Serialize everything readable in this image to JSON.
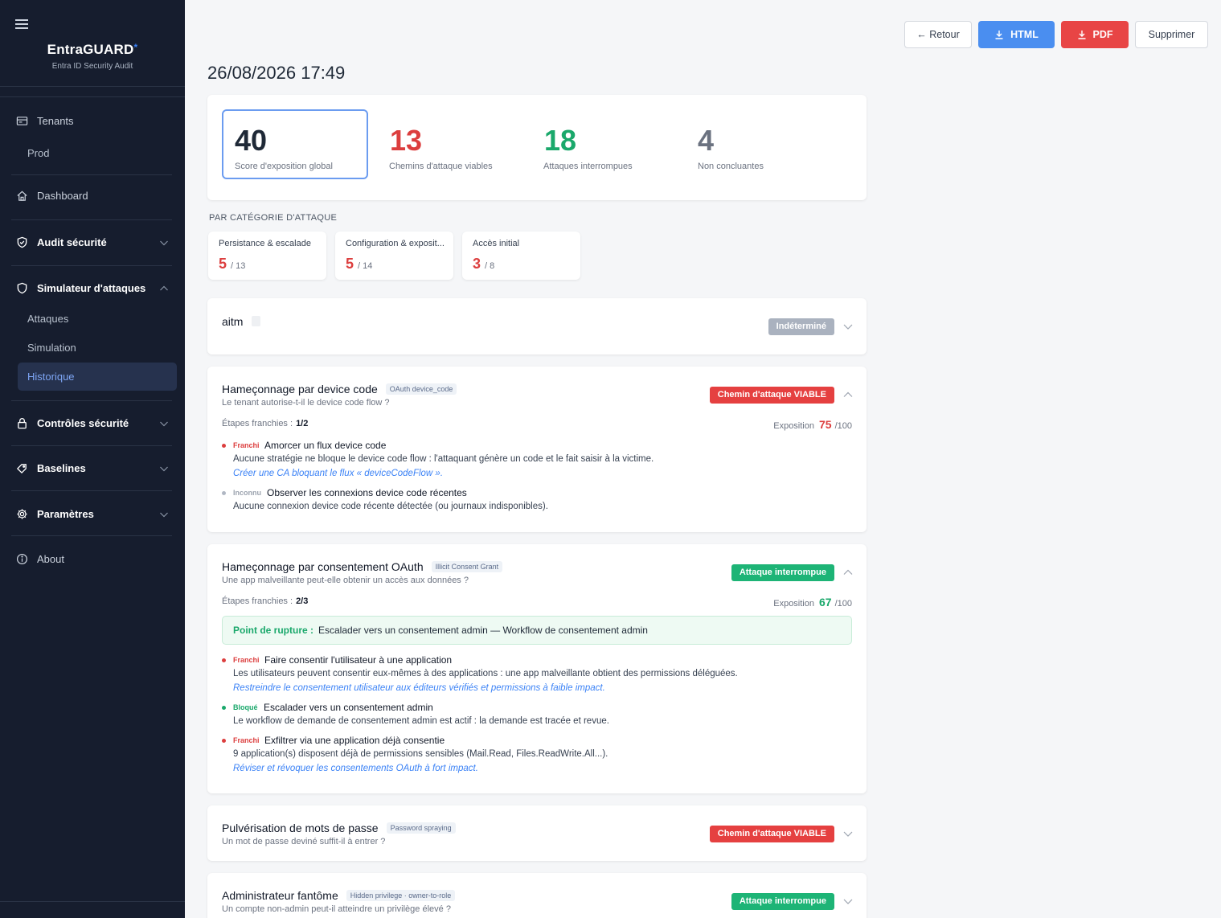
{
  "brand": {
    "title": "EntraGUARD",
    "star": "*",
    "subtitle": "Entra ID Security Audit"
  },
  "sidebar": {
    "tenants": "Tenants",
    "tenant_prod": "Prod",
    "dashboard": "Dashboard",
    "audit": "Audit sécurité",
    "simulator": "Simulateur d'attaques",
    "sim_attacks": "Attaques",
    "sim_simulation": "Simulation",
    "sim_history": "Historique",
    "controls": "Contrôles sécurité",
    "baselines": "Baselines",
    "settings": "Paramètres",
    "about": "About"
  },
  "toolbar": {
    "back": "← Retour",
    "html": "HTML",
    "pdf": "PDF",
    "delete": "Supprimer"
  },
  "page_date": "26/08/2026 17:49",
  "summary": {
    "score": {
      "value": "40",
      "label": "Score d'exposition global"
    },
    "viable": {
      "value": "13",
      "label": "Chemins d'attaque viables"
    },
    "interrupted": {
      "value": "18",
      "label": "Attaques interrompues"
    },
    "inconclusive": {
      "value": "4",
      "label": "Non concluantes"
    }
  },
  "categories_title": "PAR CATÉGORIE D'ATTAQUE",
  "categories": [
    {
      "name": "Persistance & escalade",
      "value": "5",
      "total": "/ 13"
    },
    {
      "name": "Configuration & exposit...",
      "value": "5",
      "total": "/ 14"
    },
    {
      "name": "Accès initial",
      "value": "3",
      "total": "/ 8"
    }
  ],
  "attacks": [
    {
      "title": "aitm",
      "badge": "Indéterminé"
    },
    {
      "title": "Hameçonnage par device code",
      "tag": "OAuth device_code",
      "desc": "Le tenant autorise-t-il le device code flow ?",
      "badge": "Chemin d'attaque VIABLE",
      "steps_label": "Étapes franchies :",
      "steps_value": "1/2",
      "expo_label": "Exposition",
      "expo_value": "75",
      "expo_max": "/100",
      "steps": [
        {
          "status": "Franchi",
          "title": "Amorcer un flux device code",
          "desc": "Aucune stratégie ne bloque le device code flow : l'attaquant génère un code et le fait saisir à la victime.",
          "fix": "Créer une CA bloquant le flux « deviceCodeFlow »."
        },
        {
          "status": "Inconnu",
          "title": "Observer les connexions device code récentes",
          "desc": "Aucune connexion device code récente détectée (ou journaux indisponibles)."
        }
      ]
    },
    {
      "title": "Hameçonnage par consentement OAuth",
      "tag": "Illicit Consent Grant",
      "desc": "Une app malveillante peut-elle obtenir un accès aux données ?",
      "badge": "Attaque interrompue",
      "steps_label": "Étapes franchies :",
      "steps_value": "2/3",
      "expo_label": "Exposition",
      "expo_value": "67",
      "expo_max": "/100",
      "rupture_label": "Point de rupture :",
      "rupture_text": "Escalader vers un consentement admin — Workflow de consentement admin",
      "steps": [
        {
          "status": "Franchi",
          "title": "Faire consentir l'utilisateur à une application",
          "desc": "Les utilisateurs peuvent consentir eux-mêmes à des applications : une app malveillante obtient des permissions déléguées.",
          "fix": "Restreindre le consentement utilisateur aux éditeurs vérifiés et permissions à faible impact."
        },
        {
          "status": "Bloqué",
          "title": "Escalader vers un consentement admin",
          "desc": "Le workflow de demande de consentement admin est actif : la demande est tracée et revue."
        },
        {
          "status": "Franchi",
          "title": "Exfiltrer via une application déjà consentie",
          "desc": "9 application(s) disposent déjà de permissions sensibles (Mail.Read, Files.ReadWrite.All...).",
          "fix": "Réviser et révoquer les consentements OAuth à fort impact."
        }
      ]
    },
    {
      "title": "Pulvérisation de mots de passe",
      "tag": "Password spraying",
      "desc": "Un mot de passe deviné suffit-il à entrer ?",
      "badge": "Chemin d'attaque VIABLE"
    },
    {
      "title": "Administrateur fantôme",
      "tag": "Hidden privilege · owner-to-role",
      "desc": "Un compte non-admin peut-il atteindre un privilège élevé ?",
      "badge": "Attaque interrompue"
    }
  ],
  "colors": {
    "red": "#dc3e3e",
    "green": "#1aa86b",
    "blue": "#4a8ef0",
    "sidebar": "#161d2e"
  }
}
